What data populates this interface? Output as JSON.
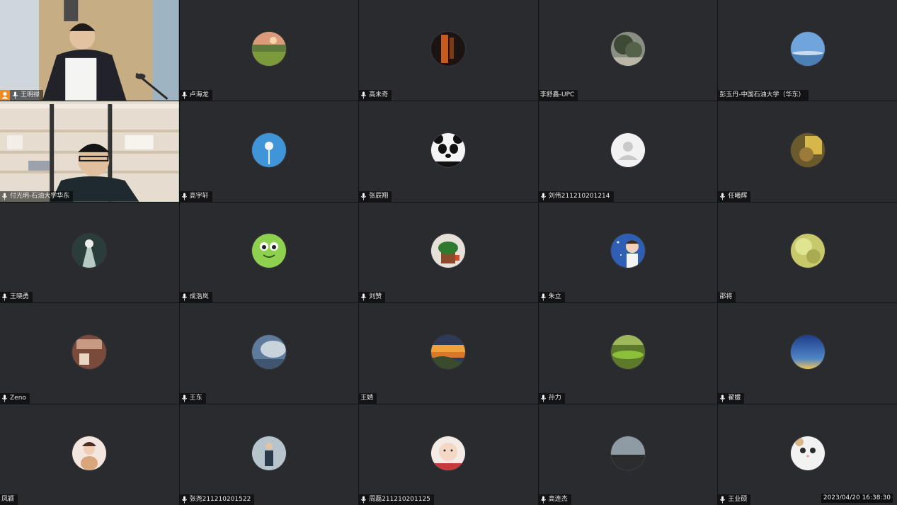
{
  "participants": [
    {
      "name": "王明禄",
      "type": "video",
      "host": true
    },
    {
      "name": "卢海龙",
      "avatar": "landscape-sunset"
    },
    {
      "name": "高未奇",
      "avatar": "dark-orange"
    },
    {
      "name": "李舒鑫-UPC",
      "avatar": "tree-photo",
      "muted_icon": false
    },
    {
      "name": "彭玉丹-中国石油大学（华东）",
      "avatar": "blue-sky",
      "muted_icon": false
    },
    {
      "name": "付光明-石油大学华东",
      "type": "video2",
      "active": true
    },
    {
      "name": "高宇轩",
      "avatar": "dandelion-sky"
    },
    {
      "name": "张辰翔",
      "avatar": "panda"
    },
    {
      "name": "刘伟211210201214",
      "avatar": "default-user"
    },
    {
      "name": "任曦辉",
      "avatar": "warm-window"
    },
    {
      "name": "王晓勇",
      "avatar": "light-rays"
    },
    {
      "name": "成浩岚",
      "avatar": "green-frog"
    },
    {
      "name": "刘赞",
      "avatar": "plant-pot"
    },
    {
      "name": "朱立",
      "avatar": "cartoon-boy"
    },
    {
      "name": "邵将",
      "avatar": "yellow-blur",
      "muted_icon": false
    },
    {
      "name": "Zeno",
      "avatar": "warm-room"
    },
    {
      "name": "王东",
      "avatar": "cloud-sky"
    },
    {
      "name": "王婧",
      "avatar": "sunset-hills",
      "muted_icon": false
    },
    {
      "name": "孙力",
      "avatar": "green-field"
    },
    {
      "name": "翟媛",
      "avatar": "blue-gradient"
    },
    {
      "name": "凤颖",
      "avatar": "child-photo",
      "muted_icon": false
    },
    {
      "name": "张尧211210201522",
      "avatar": "person-standing"
    },
    {
      "name": "周磊211210201125",
      "avatar": "baby-face"
    },
    {
      "name": "高连杰",
      "avatar": "dark-horizon"
    },
    {
      "name": "王业硕",
      "avatar": "white-cat"
    }
  ],
  "timestamp": "2023/04/20 16:38:30",
  "colors": {
    "active_border": "#3fb37f",
    "host_badge": "#f08a24",
    "tile_bg": "#2a2b2f"
  }
}
